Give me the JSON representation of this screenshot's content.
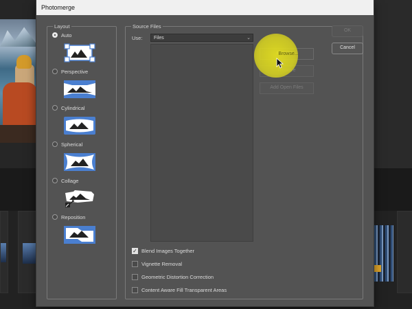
{
  "dialog": {
    "title": "Photomerge"
  },
  "layout": {
    "legend": "Layout",
    "options": [
      {
        "label": "Auto",
        "selected": true,
        "icon": "auto-layout-icon"
      },
      {
        "label": "Perspective",
        "selected": false,
        "icon": "perspective-layout-icon"
      },
      {
        "label": "Cylindrical",
        "selected": false,
        "icon": "cylindrical-layout-icon"
      },
      {
        "label": "Spherical",
        "selected": false,
        "icon": "spherical-layout-icon"
      },
      {
        "label": "Collage",
        "selected": false,
        "icon": "collage-layout-icon"
      },
      {
        "label": "Reposition",
        "selected": false,
        "icon": "reposition-layout-icon"
      }
    ]
  },
  "source": {
    "legend": "Source Files",
    "use_label": "Use:",
    "use_value": "Files",
    "browse": "Browse...",
    "remove": "Remove",
    "add_open": "Add Open Files"
  },
  "actions": {
    "ok": "OK",
    "cancel": "Cancel"
  },
  "options": [
    {
      "label": "Blend Images Together",
      "checked": true
    },
    {
      "label": "Vignette Removal",
      "checked": false
    },
    {
      "label": "Geometric Distortion Correction",
      "checked": false
    },
    {
      "label": "Content Aware Fill Transparent Areas",
      "checked": false
    }
  ],
  "colors": {
    "dialog_bg": "#535353",
    "icon_blue": "#4a7fd0",
    "highlight": "#e6e11e"
  }
}
